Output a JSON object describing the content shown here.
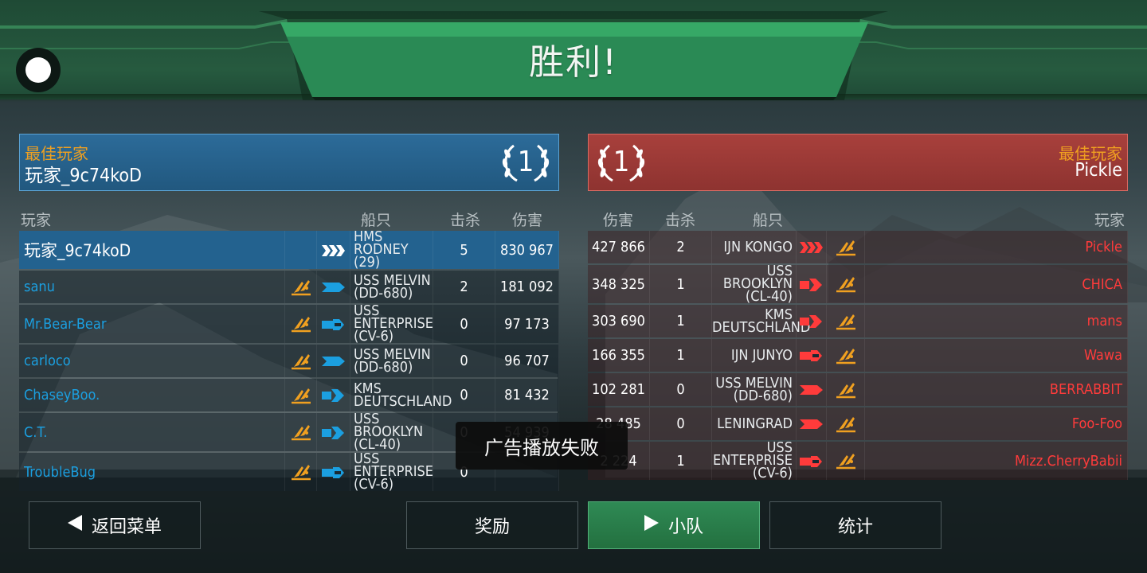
{
  "title": "胜利!",
  "colors": {
    "blue_team": "#1b9fe0",
    "red_team": "#ff3b3b",
    "best_label": "#f0a020",
    "green_bar": "#265a3f"
  },
  "blue_best": {
    "label": "最佳玩家",
    "name": "玩家_9c74koD",
    "rank": "1"
  },
  "red_best": {
    "label": "最佳玩家",
    "name": "Pickle",
    "rank": "1"
  },
  "left_headers": {
    "player": "玩家",
    "ship": "船只",
    "kills": "击杀",
    "damage": "伤害"
  },
  "right_headers": {
    "damage": "伤害",
    "kills": "击杀",
    "ship": "船只",
    "player": "玩家"
  },
  "blue_team": [
    {
      "player": "玩家_9c74koD",
      "ship1": "HMS RODNEY",
      "ship2": "(29)",
      "kills": "5",
      "damage": "830 967",
      "class_icon": "battleship-icon",
      "self": true
    },
    {
      "player": "sanu",
      "ship1": "USS MELVIN",
      "ship2": "(DD-680)",
      "kills": "2",
      "damage": "181 092",
      "class_icon": "destroyer-icon"
    },
    {
      "player": "Mr.Bear-Bear",
      "ship1": "USS ENTERPRISE",
      "ship2": "(CV-6)",
      "kills": "0",
      "damage": "97 173",
      "class_icon": "carrier-icon"
    },
    {
      "player": "carloco",
      "ship1": "USS MELVIN",
      "ship2": "(DD-680)",
      "kills": "0",
      "damage": "96 707",
      "class_icon": "destroyer-icon"
    },
    {
      "player": "ChaseyBoo.",
      "ship1": "KMS",
      "ship2": "DEUTSCHLAND",
      "kills": "0",
      "damage": "81 432",
      "class_icon": "cruiser-icon"
    },
    {
      "player": "C.T.",
      "ship1": "USS BROOKLYN",
      "ship2": "(CL-40)",
      "kills": "0",
      "damage": "54 939",
      "class_icon": "cruiser-icon"
    },
    {
      "player": "TroubleBug",
      "ship1": "USS ENTERPRISE",
      "ship2": "(CV-6)",
      "kills": "0",
      "damage": "",
      "class_icon": "carrier-icon"
    }
  ],
  "red_team": [
    {
      "damage": "427 866",
      "kills": "2",
      "ship1": "IJN KONGO",
      "ship2": "",
      "player": "Pickle",
      "class_icon": "battleship-icon"
    },
    {
      "damage": "348 325",
      "kills": "1",
      "ship1": "USS BROOKLYN",
      "ship2": "(CL-40)",
      "player": "CHICA",
      "class_icon": "cruiser-icon"
    },
    {
      "damage": "303 690",
      "kills": "1",
      "ship1": "KMS",
      "ship2": "DEUTSCHLAND",
      "player": "mans",
      "class_icon": "cruiser-icon"
    },
    {
      "damage": "166 355",
      "kills": "1",
      "ship1": "IJN JUNYO",
      "ship2": "",
      "player": "Wawa",
      "class_icon": "carrier-icon"
    },
    {
      "damage": "102 281",
      "kills": "0",
      "ship1": "USS MELVIN",
      "ship2": "(DD-680)",
      "player": "BERRABBIT",
      "class_icon": "destroyer-icon"
    },
    {
      "damage": "28 485",
      "kills": "0",
      "ship1": "LENINGRAD",
      "ship2": "",
      "player": "Foo-Foo",
      "class_icon": "destroyer-icon"
    },
    {
      "damage": "2 224",
      "kills": "1",
      "ship1": "USS ENTERPRISE",
      "ship2": "(CV-6)",
      "player": "Mizz.CherryBabii",
      "class_icon": "carrier-icon"
    }
  ],
  "toast": "广告播放失败",
  "buttons": {
    "back": "返回菜单",
    "rewards": "奖励",
    "squad": "小队",
    "stats": "统计"
  }
}
